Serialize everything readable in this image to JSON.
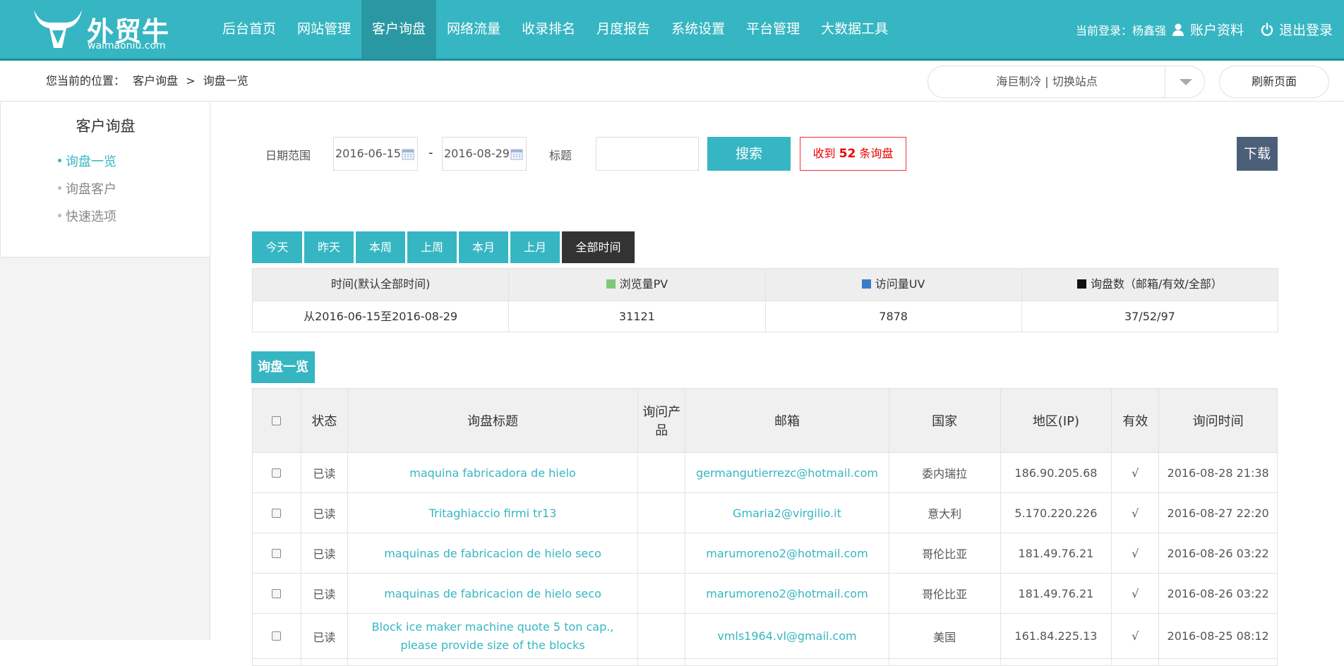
{
  "brand": {
    "name_cn": "外贸牛",
    "name_en": "waimaoniu.com",
    "color": "#36b6c2"
  },
  "nav": [
    {
      "label": "后台首页"
    },
    {
      "label": "网站管理"
    },
    {
      "label": "客户询盘",
      "active": true
    },
    {
      "label": "网络流量"
    },
    {
      "label": "收录排名"
    },
    {
      "label": "月度报告"
    },
    {
      "label": "系统设置"
    },
    {
      "label": "平台管理"
    },
    {
      "label": "大数据工具"
    }
  ],
  "user": {
    "login_text": "当前登录：杨鑫强",
    "account_label": "账户资料",
    "logout_label": "退出登录",
    "icons": [
      "user-icon",
      "power-icon"
    ]
  },
  "breadcrumb": {
    "prefix": "您当前的位置：",
    "items": [
      "客户询盘",
      "询盘一览"
    ],
    "separator": ">"
  },
  "site_switch": {
    "label": "海巨制冷 | 切换站点"
  },
  "refresh_label": "刷新页面",
  "sidebar": {
    "title": "客户询盘",
    "items": [
      {
        "label": "询盘一览",
        "active": true
      },
      {
        "label": "询盘客户"
      },
      {
        "label": "快速选项"
      }
    ]
  },
  "filter": {
    "date_label": "日期范围",
    "date_from": "2016-06-15",
    "date_sep": "-",
    "date_to": "2016-08-29",
    "title_label": "标题",
    "title_value": "",
    "search_label": "搜索",
    "count_prefix": "收到",
    "count_value": "52",
    "count_suffix": "条询盘",
    "download_label": "下载"
  },
  "period_tabs": [
    {
      "label": "今天"
    },
    {
      "label": "昨天"
    },
    {
      "label": "本周"
    },
    {
      "label": "上周"
    },
    {
      "label": "本月"
    },
    {
      "label": "上月"
    },
    {
      "label": "全部时间",
      "active": true
    }
  ],
  "stats": {
    "headers": [
      "时间(默认全部时间)",
      "浏览量PV",
      "访问量UV",
      "询盘数（邮箱/有效/全部）"
    ],
    "legend_colors": [
      "#7dc97a",
      "#3a7dc8",
      "#111111"
    ],
    "values": [
      "从2016-06-15至2016-08-29",
      "31121",
      "7878",
      "37/52/97"
    ]
  },
  "list": {
    "title": "询盘一览",
    "columns": [
      "状态",
      "询盘标题",
      "询问产品",
      "邮箱",
      "国家",
      "地区(IP)",
      "有效",
      "询问时间"
    ],
    "rows": [
      {
        "status": "已读",
        "title": "maquina fabricadora de hielo",
        "product": "",
        "email": "germangutierrezc@hotmail.com",
        "country": "委内瑞拉",
        "ip": "186.90.205.68",
        "valid": "√",
        "time": "2016-08-28 21:38"
      },
      {
        "status": "已读",
        "title": "Tritaghiaccio firmi tr13",
        "product": "",
        "email": "Gmaria2@virgilio.it",
        "country": "意大利",
        "ip": "5.170.220.226",
        "valid": "√",
        "time": "2016-08-27 22:20"
      },
      {
        "status": "已读",
        "title": "maquinas de fabricacion de hielo seco",
        "product": "",
        "email": "marumoreno2@hotmail.com",
        "country": "哥伦比亚",
        "ip": "181.49.76.21",
        "valid": "√",
        "time": "2016-08-26 03:22"
      },
      {
        "status": "已读",
        "title": "maquinas de fabricacion de hielo seco",
        "product": "",
        "email": "marumoreno2@hotmail.com",
        "country": "哥伦比亚",
        "ip": "181.49.76.21",
        "valid": "√",
        "time": "2016-08-26 03:22"
      },
      {
        "status": "已读",
        "title": "Block ice maker machine quote 5 ton cap., please provide size of the blocks",
        "product": "",
        "email": "vmls1964.vl@gmail.com",
        "country": "美国",
        "ip": "161.84.225.13",
        "valid": "√",
        "time": "2016-08-25 08:12"
      }
    ]
  }
}
